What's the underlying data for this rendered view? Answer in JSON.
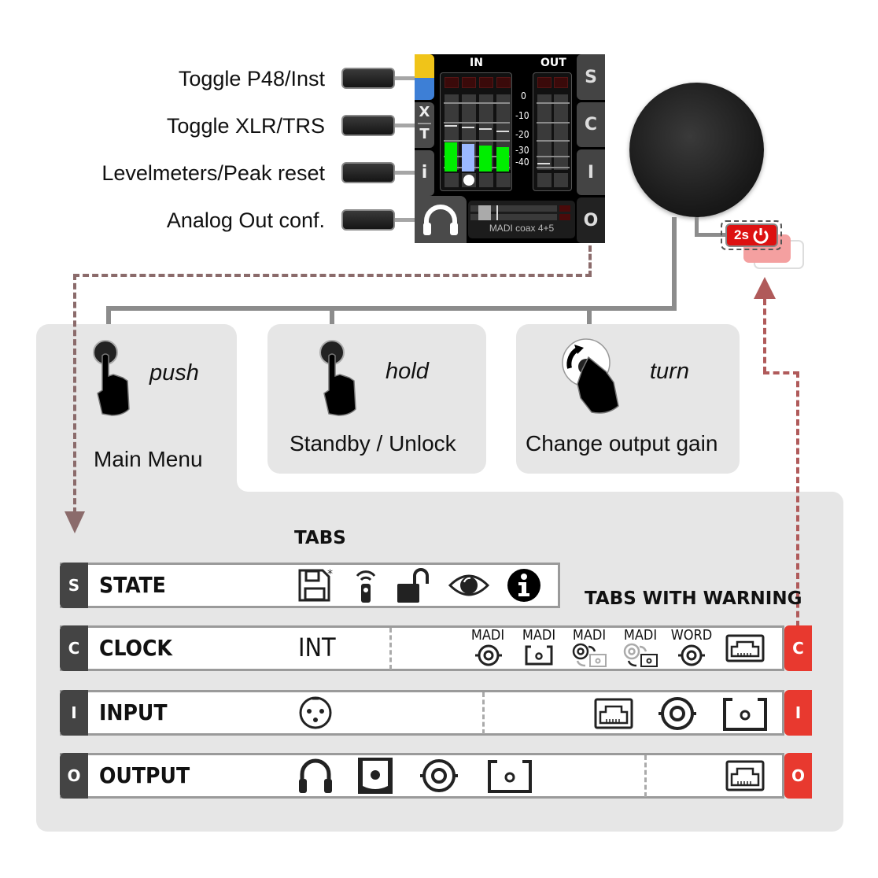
{
  "hardware_buttons": [
    {
      "label": "Toggle P48/Inst"
    },
    {
      "label": "Toggle XLR/TRS"
    },
    {
      "label": "Levelmeters/Peak reset"
    },
    {
      "label": "Analog Out conf."
    }
  ],
  "screen": {
    "in_label": "IN",
    "out_label": "OUT",
    "scale": [
      "0",
      "-10",
      "-20",
      "-30",
      "-40"
    ],
    "left_keys": [
      "X",
      "T",
      "i"
    ],
    "right_keys": [
      "S",
      "C",
      "I",
      "O"
    ],
    "output_name": "MADI coax 4+5",
    "colors": {
      "yellow": "#f0c419",
      "blue": "#3d7fd6",
      "meter_green": "#00ee00",
      "meter_selected": "#9bb8ff"
    }
  },
  "knob": {
    "standby_badge": "2s",
    "badge_color": "#dd1111"
  },
  "actions": [
    {
      "verb": "push",
      "description": "Main Menu"
    },
    {
      "verb": "hold",
      "description": "Standby / Unlock"
    },
    {
      "verb": "turn",
      "description": "Change output gain"
    }
  ],
  "tabs_heading": "TABS",
  "warning_heading": "TABS WITH WARNING",
  "tabs": [
    {
      "letter": "S",
      "title": "STATE",
      "icons": [
        "save-icon",
        "remote-icon",
        "unlock-icon",
        "eye-icon",
        "info-icon"
      ]
    },
    {
      "letter": "C",
      "title": "CLOCK",
      "value": "INT",
      "sources": [
        {
          "label": "MADI",
          "icon": "bnc-icon"
        },
        {
          "label": "MADI",
          "icon": "optical-icon"
        },
        {
          "label": "MADI",
          "icon": "redundant-coax-icon"
        },
        {
          "label": "MADI",
          "icon": "redundant-optical-icon"
        },
        {
          "label": "WORD",
          "icon": "bnc-icon"
        },
        {
          "label": "",
          "icon": "ethernet-icon"
        }
      ],
      "warn_letter": "C"
    },
    {
      "letter": "I",
      "title": "INPUT",
      "icons": [
        "xlr-icon"
      ],
      "right_icons": [
        "ethernet-icon",
        "bnc-icon",
        "optical-icon"
      ],
      "warn_letter": "I"
    },
    {
      "letter": "O",
      "title": "OUTPUT",
      "icons": [
        "headphones-icon",
        "speaker-icon",
        "bnc-icon",
        "optical-icon"
      ],
      "right_icons": [
        "ethernet-icon"
      ],
      "warn_letter": "O"
    }
  ],
  "colors": {
    "warning": "#e8392f",
    "panel": "#e6e6e6",
    "arrow": "#8b6b6b"
  }
}
